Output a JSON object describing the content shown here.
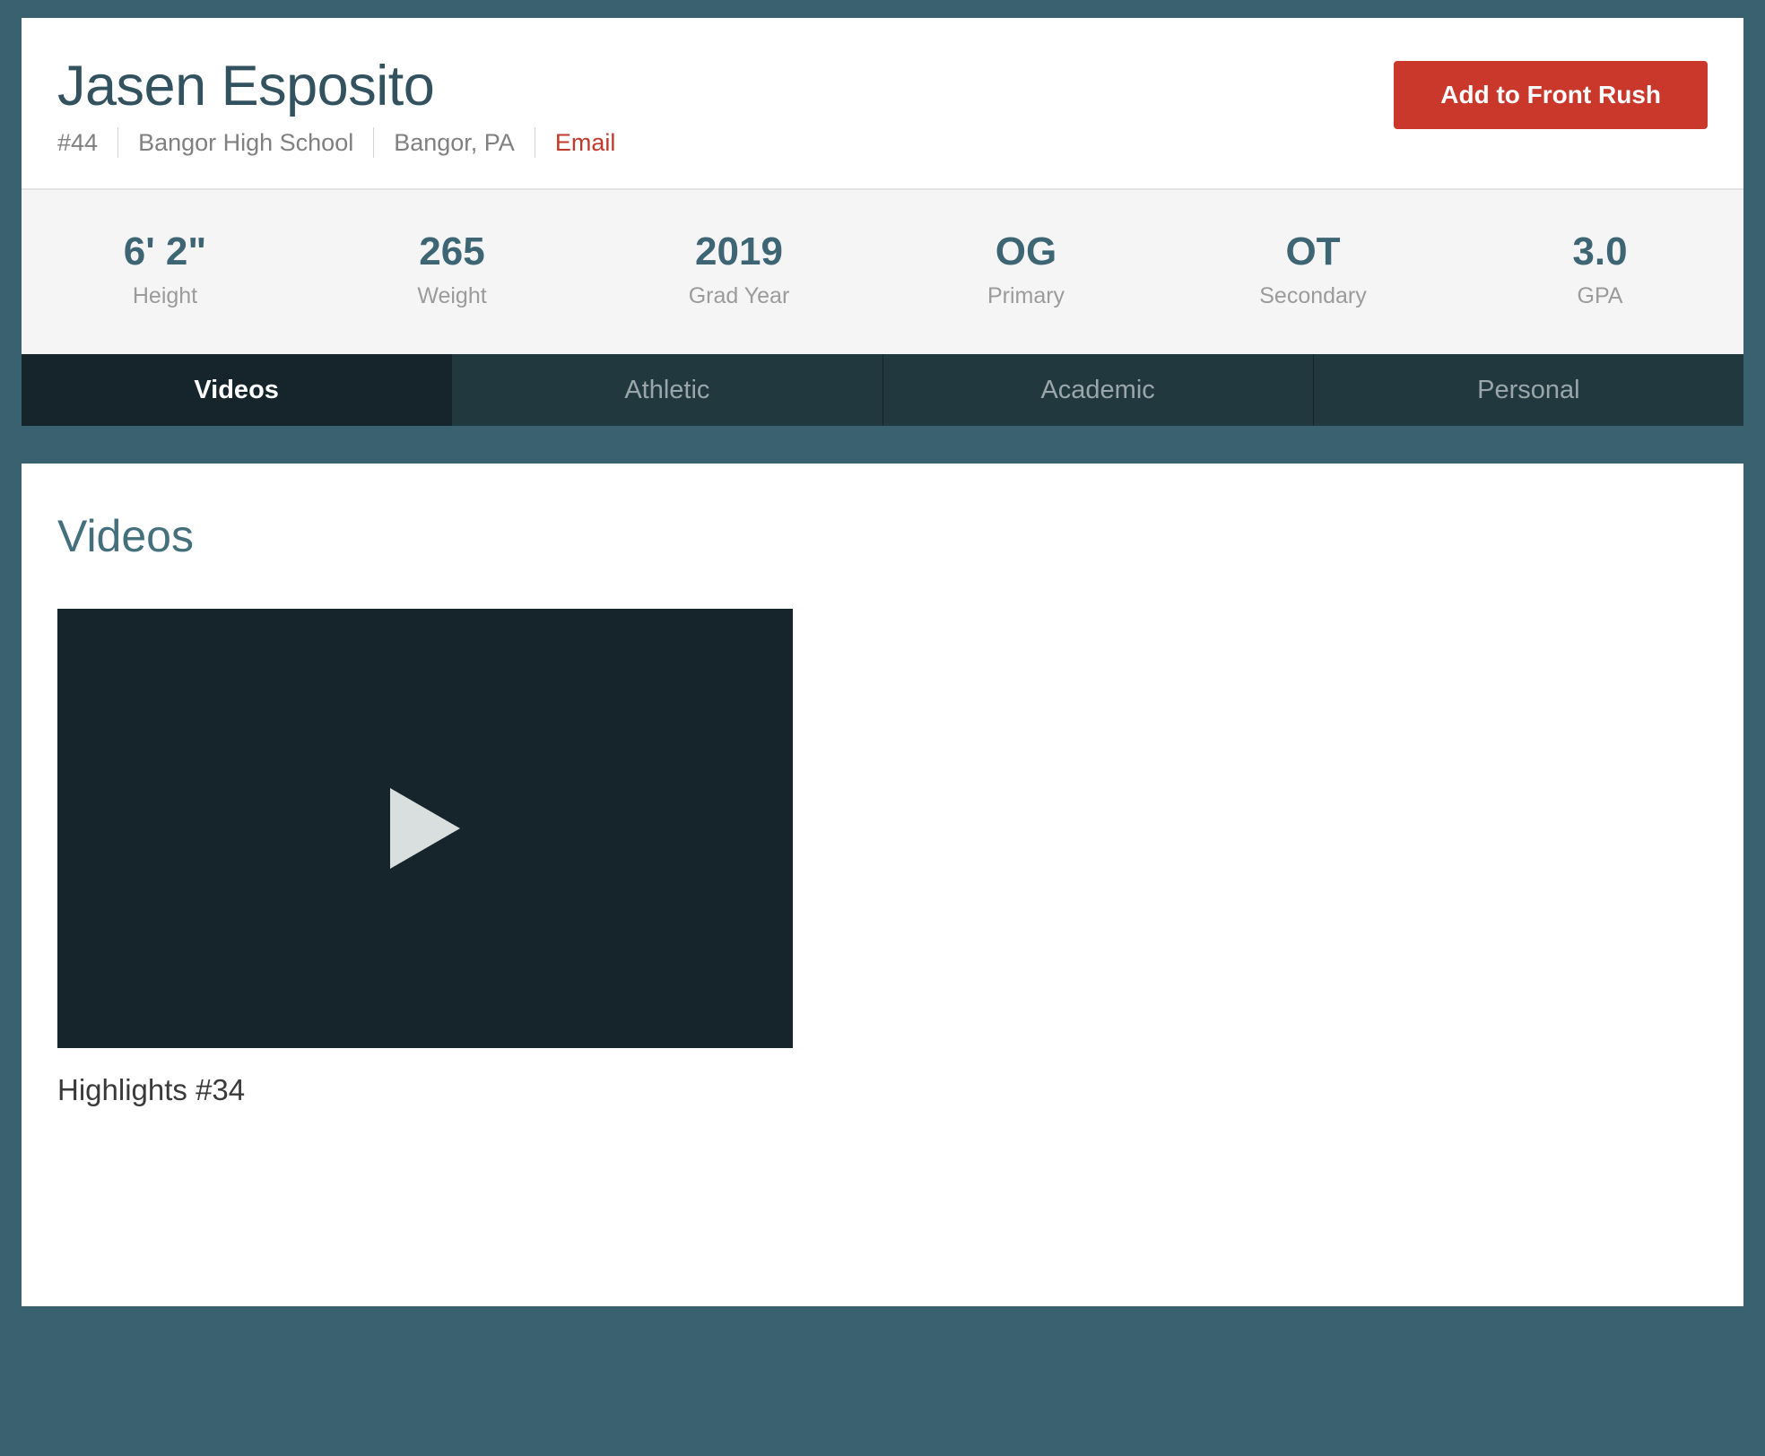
{
  "theme": {
    "page_background": "#3a6170",
    "accent_red": "#ca382c",
    "heading_teal": "#44707d",
    "tab_active_bg": "#16252b",
    "tab_inactive_bg": "#22383f",
    "stats_bg": "#f5f5f5"
  },
  "profile": {
    "name": "Jasen Esposito",
    "jersey_number": "#44",
    "school": "Bangor High School",
    "location": "Bangor, PA",
    "email_link_label": "Email",
    "add_button_label": "Add to Front Rush"
  },
  "stats": [
    {
      "value": "6' 2\"",
      "label": "Height"
    },
    {
      "value": "265",
      "label": "Weight"
    },
    {
      "value": "2019",
      "label": "Grad Year"
    },
    {
      "value": "OG",
      "label": "Primary"
    },
    {
      "value": "OT",
      "label": "Secondary"
    },
    {
      "value": "3.0",
      "label": "GPA"
    }
  ],
  "tabs": [
    {
      "label": "Videos",
      "active": true
    },
    {
      "label": "Athletic",
      "active": false
    },
    {
      "label": "Academic",
      "active": false
    },
    {
      "label": "Personal",
      "active": false
    }
  ],
  "videos_section": {
    "title": "Videos",
    "items": [
      {
        "caption": "Highlights #34",
        "play_icon": "play-icon"
      }
    ]
  }
}
